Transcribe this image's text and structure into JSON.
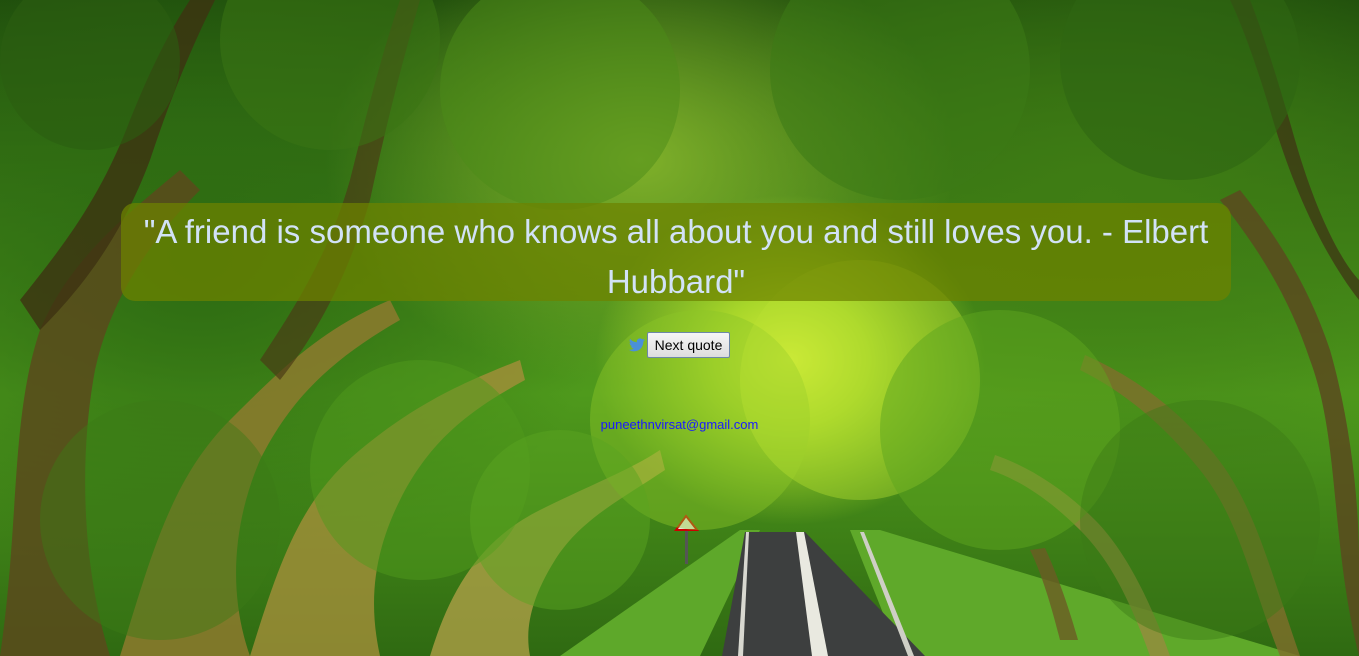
{
  "quote": {
    "text": "\"A friend is someone who knows all about you and still loves you. - Elbert Hubbard\""
  },
  "controls": {
    "tweet_icon": "twitter-bird-icon",
    "next_label": "Next quote"
  },
  "footer": {
    "email": "puneethnvirsat@gmail.com"
  },
  "colors": {
    "quote_box": "#6e8200",
    "quote_text": "#d2e2f7",
    "link": "#1a1aff",
    "twitter_blue": "#4a90d9"
  }
}
